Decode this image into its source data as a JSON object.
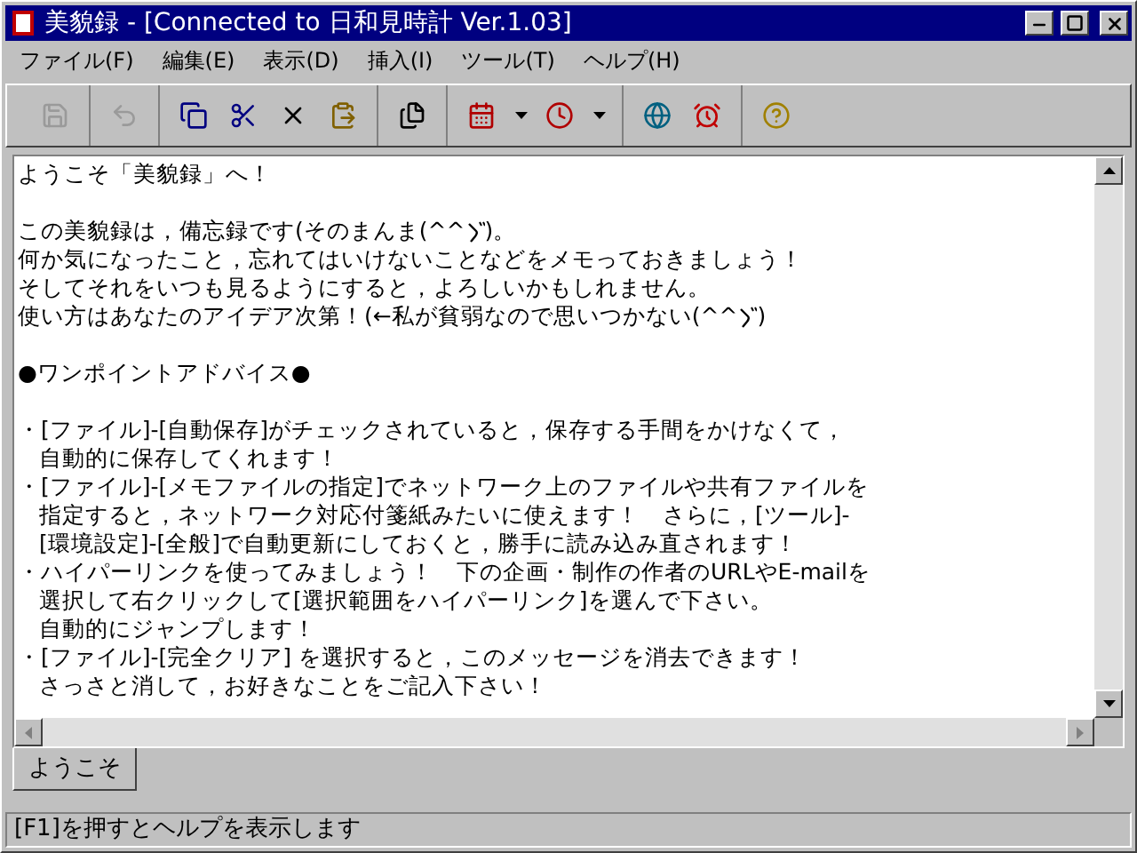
{
  "window": {
    "title": "美貌録 - [Connected to  日和見時計 Ver.1.03]"
  },
  "menu": [
    "ファイル(F)",
    "編集(E)",
    "表示(D)",
    "挿入(I)",
    "ツール(T)",
    "ヘルプ(H)"
  ],
  "toolbar": [
    [
      {
        "kind": "save",
        "disabled": true
      }
    ],
    [
      {
        "kind": "undo",
        "disabled": true
      }
    ],
    [
      {
        "kind": "copy",
        "disabled": false
      },
      {
        "kind": "cut",
        "disabled": false
      },
      {
        "kind": "delete",
        "disabled": false
      },
      {
        "kind": "paste",
        "disabled": false
      }
    ],
    [
      {
        "kind": "pages",
        "disabled": false
      }
    ],
    [
      {
        "kind": "calendar",
        "disabled": false
      },
      {
        "kind": "dropdown",
        "disabled": false
      },
      {
        "kind": "clock",
        "disabled": false
      },
      {
        "kind": "dropdown",
        "disabled": false
      }
    ],
    [
      {
        "kind": "globe",
        "disabled": false
      },
      {
        "kind": "alarm",
        "disabled": false
      }
    ],
    [
      {
        "kind": "help",
        "disabled": false
      }
    ]
  ],
  "editor": {
    "paragraphs": [
      {
        "lines": [
          "ようこそ「美貌録」へ！"
        ]
      },
      {
        "lines": [
          [
            "この美貌録は，備忘録です(そのまんま(^^",
            {
              "kind": "iteration_mark"
            },
            ")。"
          ],
          "何か気になったこと，忘れてはいけないことなどをメモっておきましょう！",
          "そしてそれをいつも見るようにすると，よろしいかもしれません。",
          [
            "使い方はあなたのアイデア次第！(←私が貧弱なので思いつかない(^^",
            {
              "kind": "iteration_mark"
            },
            ")"
          ]
        ]
      },
      {
        "lines": [
          "●ワンポイントアドバイス●"
        ]
      },
      {
        "tips": [
          {
            "lines": [
              "・[ファイル]-[自動保存]がチェックされていると，保存する手間をかけなくて，",
              "自動的に保存してくれます！"
            ]
          },
          {
            "lines": [
              "・[ファイル]-[メモファイルの指定]でネットワーク上のファイルや共有ファイルを",
              "指定すると，ネットワーク対応付箋紙みたいに使えます！　さらに，[ツール]-",
              "[環境設定]-[全般]で自動更新にしておくと，勝手に読み込み直されます！"
            ]
          },
          {
            "lines": [
              "・ハイパーリンクを使ってみましょう！　下の企画・制作の作者のURLやE-mailを",
              "選択して右クリックして[選択範囲をハイパーリンク]を選んで下さい。",
              "自動的にジャンプします！"
            ]
          },
          {
            "lines": [
              "・[ファイル]-[完全クリア] を選択すると，このメッセージを消去できます！",
              "さっさと消して，お好きなことをご記入下さい！"
            ]
          }
        ]
      }
    ]
  },
  "tabs": [
    {
      "label": "ようこそ",
      "selected": true
    }
  ],
  "status_bar": "[F1]を押すとヘルプを表示します"
}
